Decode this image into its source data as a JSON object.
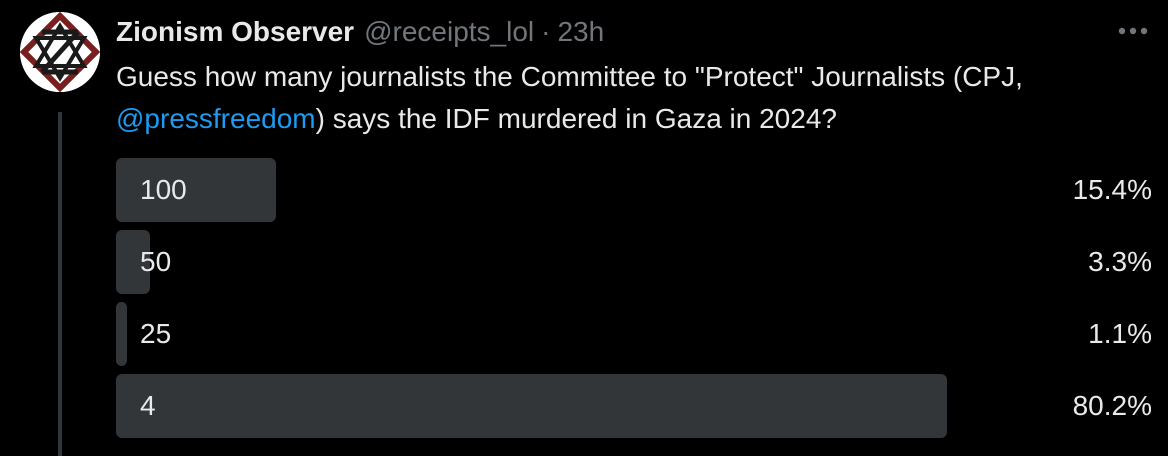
{
  "tweet": {
    "display_name": "Zionism Observer",
    "handle": "@receipts_lol",
    "separator": "·",
    "time": "23h",
    "more_icon": "more-horizontal-icon",
    "text_before": "Guess how many journalists the Committee to \"Protect\" Journalists (CPJ, ",
    "mention": "@pressfreedom",
    "text_after": ")  says the IDF murdered in Gaza in 2024?",
    "accent_color": "#1d9bf0"
  },
  "poll": {
    "options": [
      {
        "label": "100",
        "percent_text": "15.4%",
        "percent": 15.4
      },
      {
        "label": "50",
        "percent_text": "3.3%",
        "percent": 3.3
      },
      {
        "label": "25",
        "percent_text": "1.1%",
        "percent": 1.1
      },
      {
        "label": "4",
        "percent_text": "80.2%",
        "percent": 80.2
      }
    ]
  }
}
